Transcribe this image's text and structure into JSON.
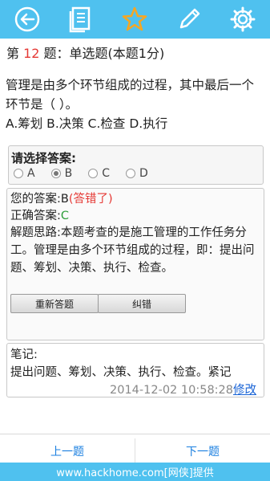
{
  "toolbar": {
    "icons": [
      "back-icon",
      "document-icon",
      "star-icon",
      "pencil-icon",
      "gear-icon"
    ],
    "bg_color": "#4fc1ef"
  },
  "question": {
    "prefix": "第 ",
    "number": "12",
    "suffix": " 题：单选题(本题1分)",
    "stem": "管理是由多个环节组成的过程，其中最后一个环节是（    ）。",
    "options_line": "A.筹划 B.决策 C.检查 D.执行"
  },
  "answer_select": {
    "title": "请选择答案:",
    "options": [
      "A",
      "B",
      "C",
      "D"
    ],
    "selected": "B"
  },
  "result": {
    "your_answer_label": "您的答案:",
    "your_answer_value": "B",
    "your_answer_status": "(答错了)",
    "correct_label": "正确答案:",
    "correct_value": "C",
    "analysis": "解题思路:本题考查的是施工管理的工作任务分工。管理是由多个环节组成的过程，即：提出问题、筹划、决策、执行、检查。",
    "retry_label": "重新答题",
    "report_label": "纠错"
  },
  "note": {
    "label": "笔记:",
    "text": "提出问题、筹划、决策、执行、检查。紧记",
    "timestamp": "2014-12-02 10:58:28",
    "edit_label": "修改"
  },
  "footer": {
    "prev_label": "上一题",
    "next_label": "下一题"
  },
  "watermark": "www.hackhome.com[网侠]提供"
}
